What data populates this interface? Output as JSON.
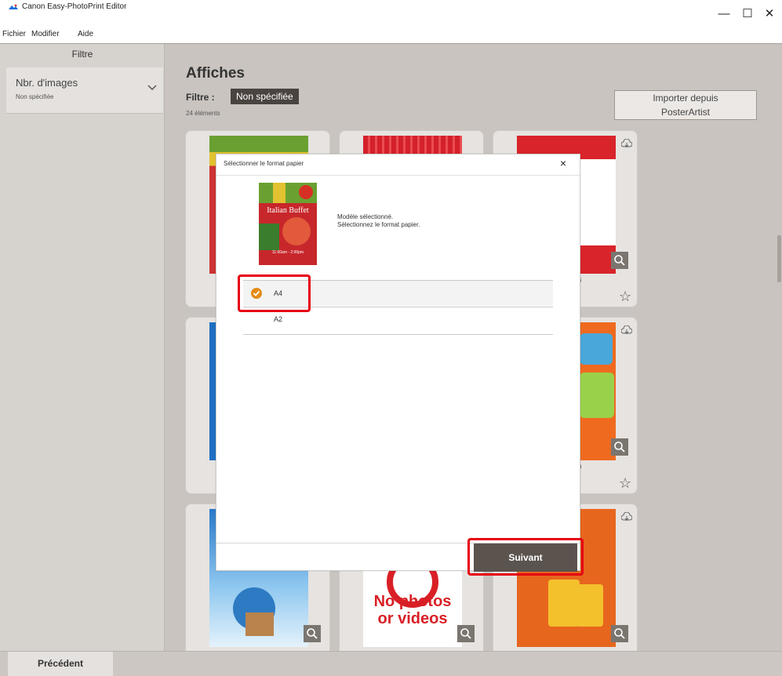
{
  "window": {
    "title": "Canon Easy-PhotoPrint Editor",
    "minimize_glyph": "—",
    "maximize_glyph": "☐",
    "close_glyph": "✕"
  },
  "menu": [
    "Fichier",
    "Modifier",
    "Aide"
  ],
  "sidebar": {
    "header": "Filtre",
    "filter_card": {
      "label": "Nbr. d'images",
      "value": "Non spécifiée",
      "icon": "chevron-down-icon"
    }
  },
  "main": {
    "title": "Affiches",
    "filter_label": "Filtre :",
    "filter_value": "Non spécifiée",
    "item_count": "24 éléments",
    "import_button": {
      "line1": "Importer depuis",
      "line2": "PosterArtist"
    }
  },
  "cards": {
    "row1_captions": [
      "",
      "",
      "6"
    ],
    "row2_captions": [
      "",
      "",
      "9"
    ],
    "row3": {
      "card2_text1": "No photos",
      "card2_text2": "or videos"
    }
  },
  "dialog": {
    "title": "Sélectionner le format papier",
    "close_glyph": "×",
    "thumbnail_text": "Italian Buffet",
    "thumbnail_time": "11:00am - 2:00pm",
    "message_line1": "Modèle sélectionné.",
    "message_line2": "Sélectionnez le format papier.",
    "sizes": [
      "A4",
      "A2"
    ],
    "selected_size": "A4",
    "next_button": "Suivant"
  },
  "footer": {
    "back_button": "Précédent"
  },
  "colors": {
    "highlight": "#e60012",
    "check": "#e58b17",
    "button_dark": "#5a534e"
  }
}
